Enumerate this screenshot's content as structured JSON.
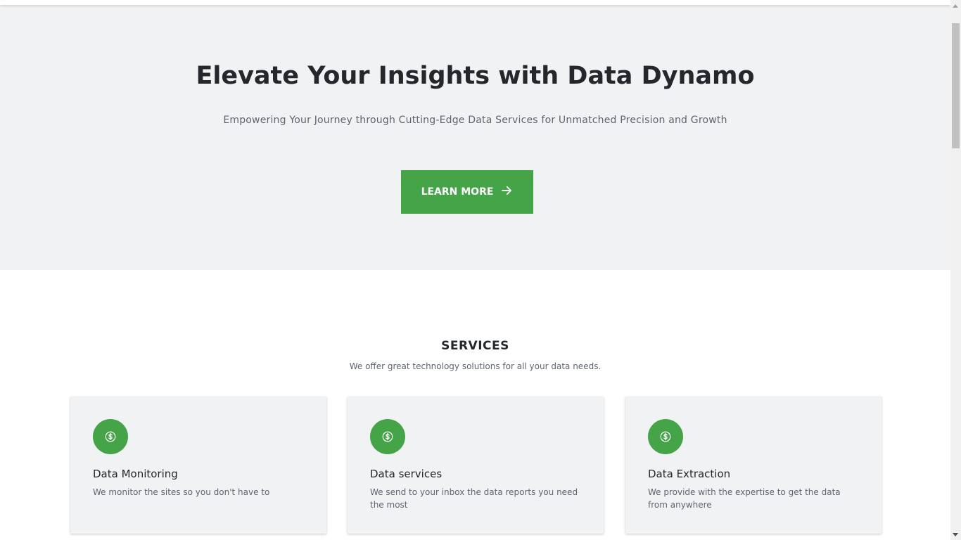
{
  "hero": {
    "title": "Elevate Your Insights with Data Dynamo",
    "subtitle": "Empowering Your Journey through Cutting-Edge Data Services for Unmatched Precision and Growth",
    "button_label": "LEARN MORE",
    "button_icon": "arrow-right-icon"
  },
  "services": {
    "title": "SERVICES",
    "subtitle": "We offer great technology solutions for all your data needs.",
    "cards": [
      {
        "icon": "dollar-circle-icon",
        "title": "Data Monitoring",
        "description": "We monitor the sites so you don't have to"
      },
      {
        "icon": "dollar-circle-icon",
        "title": "Data services",
        "description": "We send to your inbox the data reports you need the most"
      },
      {
        "icon": "dollar-circle-icon",
        "title": "Data Extraction",
        "description": "We provide with the expertise to get the data from anywhere"
      }
    ]
  },
  "colors": {
    "accent": "#45a348",
    "hero_background": "#f1f2f4",
    "heading": "#24272b",
    "muted_text": "#5d6470"
  }
}
